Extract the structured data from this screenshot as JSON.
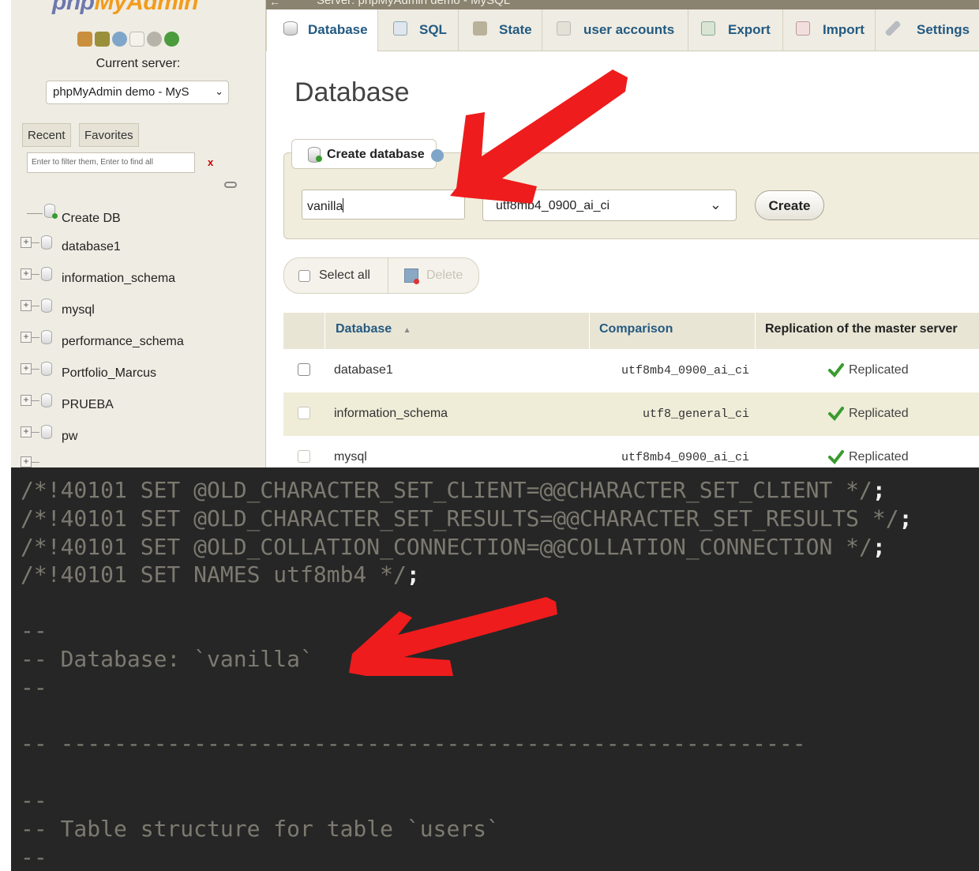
{
  "nav": {
    "logo_part1": "php",
    "logo_part2": "MyAdmin",
    "current_server_label": "Current server:",
    "server_select_value": "phpMyAdmin demo - MyS",
    "tabs": [
      "Recent",
      "Favorites"
    ],
    "filter_placeholder": "Enter to filter them, Enter to find all",
    "filter_clear": "x",
    "create_db": "Create DB",
    "databases": [
      "database1",
      "information_schema",
      "mysql",
      "performance_schema",
      "Portfolio_Marcus",
      "PRUEBA",
      "pw"
    ]
  },
  "server_bar": {
    "title": "Server: phpMyAdmin demo - MySQL"
  },
  "tabs": [
    {
      "label": "Database",
      "icon": "database-icon",
      "active": true
    },
    {
      "label": "SQL",
      "icon": "sql-icon"
    },
    {
      "label": "State",
      "icon": "status-icon"
    },
    {
      "label": "user accounts",
      "icon": "users-icon"
    },
    {
      "label": "Export",
      "icon": "export-icon"
    },
    {
      "label": "Import",
      "icon": "import-icon"
    },
    {
      "label": "Settings",
      "icon": "wrench-icon"
    }
  ],
  "page": {
    "heading": "Database",
    "create_legend": "Create database",
    "db_name_value": "vanilla",
    "collation_value": "utf8mb4_0900_ai_ci",
    "create_button": "Create",
    "select_all": "Select all",
    "delete": "Delete"
  },
  "table": {
    "headers": [
      "Database",
      "Comparison",
      "Replication of the master server"
    ],
    "sort_indicator": "▲",
    "rows": [
      {
        "name": "database1",
        "collation": "utf8mb4_0900_ai_ci",
        "replication": "Replicated"
      },
      {
        "name": "information_schema",
        "collation": "utf8_general_ci",
        "replication": "Replicated"
      },
      {
        "name": "mysql",
        "collation": "utf8mb4_0900_ai_ci",
        "replication": "Replicated"
      }
    ]
  },
  "code": {
    "lines": [
      "/*!40101 SET @OLD_CHARACTER_SET_CLIENT=@@CHARACTER_SET_CLIENT */",
      "/*!40101 SET @OLD_CHARACTER_SET_RESULTS=@@CHARACTER_SET_RESULTS */",
      "/*!40101 SET @OLD_COLLATION_CONNECTION=@@COLLATION_CONNECTION */",
      "/*!40101 SET NAMES utf8mb4 */",
      "--",
      "-- Database: `vanilla`",
      "--",
      "-- --------------------------------------------------------",
      "--",
      "-- Table structure for table `users`",
      "--"
    ],
    "semicolon": ";"
  },
  "colors": {
    "accent_blue": "#235a81",
    "panel_beige": "#f0eddc",
    "code_bg": "#262626",
    "arrow_red": "#ee1c1c",
    "check_green": "#3a9b2f"
  }
}
